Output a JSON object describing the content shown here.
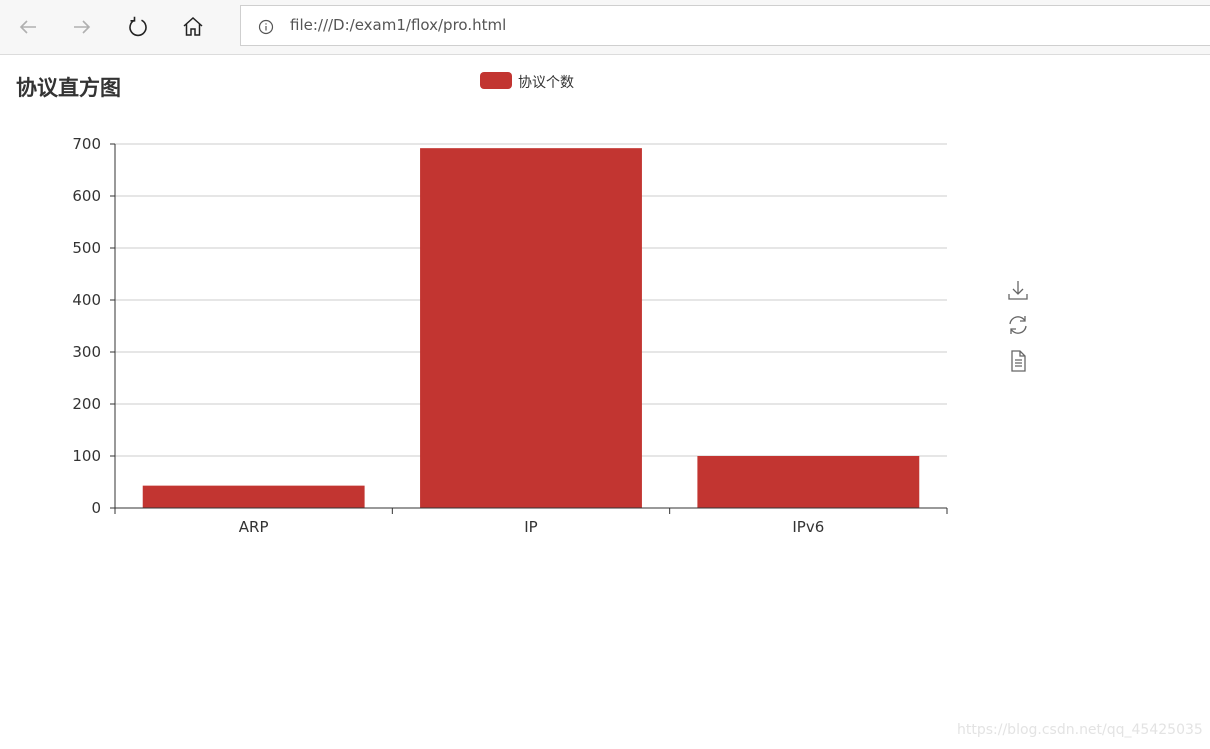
{
  "browser": {
    "url": "file:///D:/exam1/flox/pro.html",
    "icons": [
      "back-arrow-icon",
      "forward-arrow-icon",
      "refresh-icon",
      "home-icon",
      "info-icon"
    ]
  },
  "page": {
    "watermark": "https://blog.csdn.net/qq_45425035"
  },
  "toolbox": {
    "icons": [
      "save-as-image-icon",
      "restore-icon",
      "data-view-icon"
    ]
  },
  "chart_data": {
    "type": "bar",
    "title": "协议直方图",
    "categories": [
      "ARP",
      "IP",
      "IPv6"
    ],
    "series": [
      {
        "name": "协议个数",
        "values": [
          43,
          692,
          100
        ],
        "color": "#c23531"
      }
    ],
    "yticks": [
      0,
      100,
      200,
      300,
      400,
      500,
      600,
      700
    ],
    "ylim": [
      0,
      700
    ],
    "grid": true,
    "legend_position": "top-center"
  }
}
